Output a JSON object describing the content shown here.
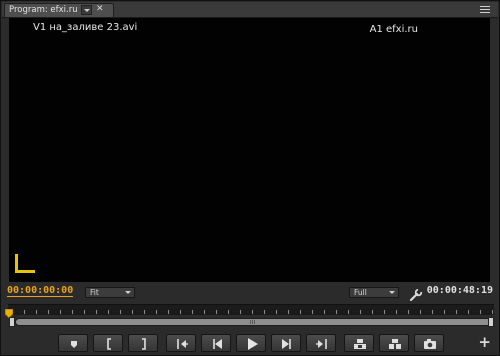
{
  "tab": {
    "title": "Program: efxi.ru"
  },
  "video": {
    "overlay_v1": "V1 на_заливе 23.avi",
    "overlay_a1": "A1 efxi.ru"
  },
  "controls": {
    "timecode_current": "00:00:00:00",
    "zoom_select": "Fit",
    "resolution_select": "Full",
    "timecode_duration": "00:00:48:19"
  },
  "colors": {
    "current_timecode": "#e9a21b",
    "safe_margin_marker": "#e8c400"
  },
  "transport": [
    "add-marker",
    "mark-in",
    "mark-out",
    "go-to-in",
    "step-back",
    "play",
    "step-forward",
    "go-to-out",
    "lift",
    "extract",
    "export-frame"
  ],
  "add_button_label": "+"
}
